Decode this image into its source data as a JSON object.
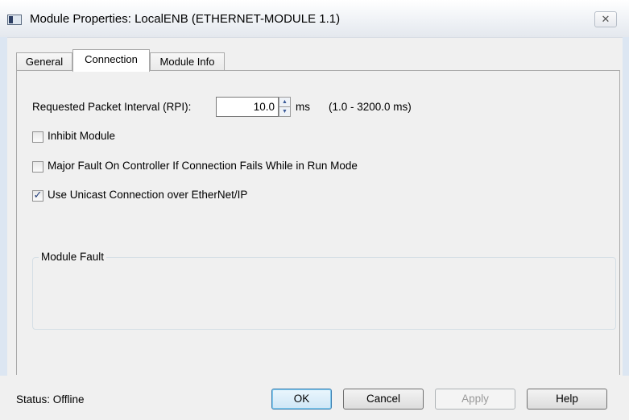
{
  "window": {
    "title": "Module Properties: LocalENB (ETHERNET-MODULE 1.1)",
    "close_glyph": "✕",
    "icon": "module-window-icon"
  },
  "tabs": [
    {
      "label": "General",
      "active": false
    },
    {
      "label": "Connection",
      "active": true
    },
    {
      "label": "Module Info",
      "active": false
    }
  ],
  "connection": {
    "rpi_label": "Requested Packet Interval (RPI):",
    "rpi_value": "10.0",
    "rpi_unit": "ms",
    "rpi_range": "(1.0 - 3200.0 ms)",
    "options": [
      {
        "label": "Inhibit Module",
        "checked": false
      },
      {
        "label": "Major Fault On Controller If Connection Fails While in Run Mode",
        "checked": false
      },
      {
        "label": "Use Unicast Connection over EtherNet/IP",
        "checked": true
      }
    ],
    "module_fault_label": "Module Fault"
  },
  "footer": {
    "status": "Status:  Offline",
    "ok_label": "OK",
    "cancel_label": "Cancel",
    "apply_label": "Apply",
    "help_label": "Help"
  }
}
